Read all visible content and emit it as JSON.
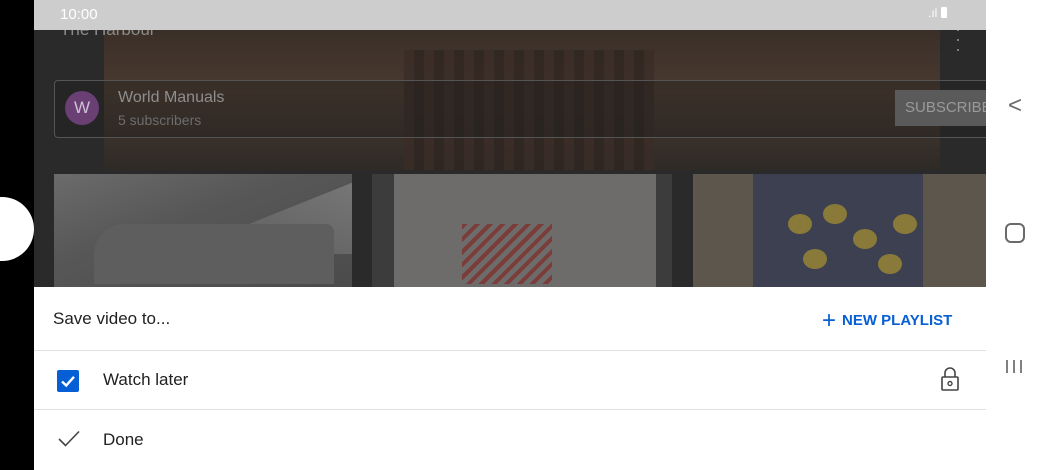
{
  "status_bar": {
    "time": "10:00",
    "signal": ".ıl"
  },
  "video": {
    "title": "The Harbour",
    "menu_icon": "more-vertical-icon"
  },
  "channel": {
    "avatar_letter": "W",
    "name": "World Manuals",
    "subscribers": "5 subscribers",
    "subscribe_label": "SUBSCRIBE"
  },
  "sheet": {
    "title": "Save video to...",
    "new_playlist_label": "NEW PLAYLIST",
    "playlists": [
      {
        "label": "Watch later",
        "checked": true,
        "privacy_icon": "lock-icon"
      }
    ],
    "done_label": "Done"
  },
  "nav_bar": {
    "back": "<",
    "recents": "III"
  },
  "colors": {
    "accent": "#065fd4",
    "scrim": "#2a2a2a",
    "status_bar": "#cdcdcd"
  }
}
